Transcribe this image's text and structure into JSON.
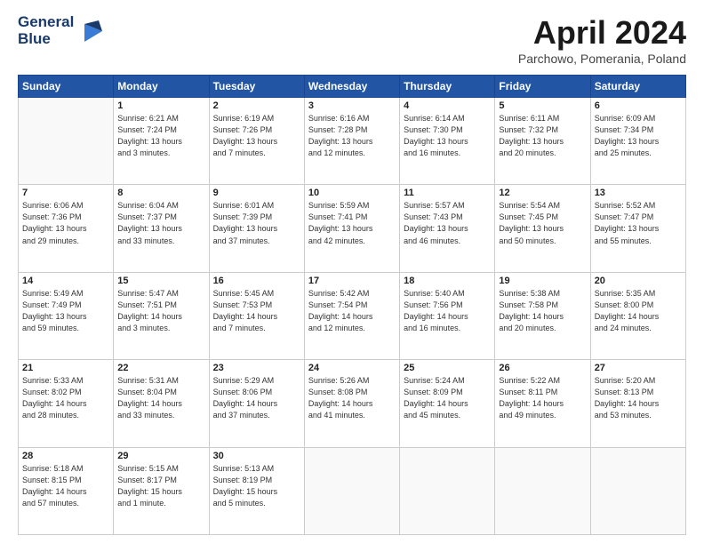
{
  "logo": {
    "line1": "General",
    "line2": "Blue"
  },
  "header": {
    "title": "April 2024",
    "location": "Parchowo, Pomerania, Poland"
  },
  "days_of_week": [
    "Sunday",
    "Monday",
    "Tuesday",
    "Wednesday",
    "Thursday",
    "Friday",
    "Saturday"
  ],
  "weeks": [
    [
      {
        "day": "",
        "info": ""
      },
      {
        "day": "1",
        "info": "Sunrise: 6:21 AM\nSunset: 7:24 PM\nDaylight: 13 hours\nand 3 minutes."
      },
      {
        "day": "2",
        "info": "Sunrise: 6:19 AM\nSunset: 7:26 PM\nDaylight: 13 hours\nand 7 minutes."
      },
      {
        "day": "3",
        "info": "Sunrise: 6:16 AM\nSunset: 7:28 PM\nDaylight: 13 hours\nand 12 minutes."
      },
      {
        "day": "4",
        "info": "Sunrise: 6:14 AM\nSunset: 7:30 PM\nDaylight: 13 hours\nand 16 minutes."
      },
      {
        "day": "5",
        "info": "Sunrise: 6:11 AM\nSunset: 7:32 PM\nDaylight: 13 hours\nand 20 minutes."
      },
      {
        "day": "6",
        "info": "Sunrise: 6:09 AM\nSunset: 7:34 PM\nDaylight: 13 hours\nand 25 minutes."
      }
    ],
    [
      {
        "day": "7",
        "info": "Sunrise: 6:06 AM\nSunset: 7:36 PM\nDaylight: 13 hours\nand 29 minutes."
      },
      {
        "day": "8",
        "info": "Sunrise: 6:04 AM\nSunset: 7:37 PM\nDaylight: 13 hours\nand 33 minutes."
      },
      {
        "day": "9",
        "info": "Sunrise: 6:01 AM\nSunset: 7:39 PM\nDaylight: 13 hours\nand 37 minutes."
      },
      {
        "day": "10",
        "info": "Sunrise: 5:59 AM\nSunset: 7:41 PM\nDaylight: 13 hours\nand 42 minutes."
      },
      {
        "day": "11",
        "info": "Sunrise: 5:57 AM\nSunset: 7:43 PM\nDaylight: 13 hours\nand 46 minutes."
      },
      {
        "day": "12",
        "info": "Sunrise: 5:54 AM\nSunset: 7:45 PM\nDaylight: 13 hours\nand 50 minutes."
      },
      {
        "day": "13",
        "info": "Sunrise: 5:52 AM\nSunset: 7:47 PM\nDaylight: 13 hours\nand 55 minutes."
      }
    ],
    [
      {
        "day": "14",
        "info": "Sunrise: 5:49 AM\nSunset: 7:49 PM\nDaylight: 13 hours\nand 59 minutes."
      },
      {
        "day": "15",
        "info": "Sunrise: 5:47 AM\nSunset: 7:51 PM\nDaylight: 14 hours\nand 3 minutes."
      },
      {
        "day": "16",
        "info": "Sunrise: 5:45 AM\nSunset: 7:53 PM\nDaylight: 14 hours\nand 7 minutes."
      },
      {
        "day": "17",
        "info": "Sunrise: 5:42 AM\nSunset: 7:54 PM\nDaylight: 14 hours\nand 12 minutes."
      },
      {
        "day": "18",
        "info": "Sunrise: 5:40 AM\nSunset: 7:56 PM\nDaylight: 14 hours\nand 16 minutes."
      },
      {
        "day": "19",
        "info": "Sunrise: 5:38 AM\nSunset: 7:58 PM\nDaylight: 14 hours\nand 20 minutes."
      },
      {
        "day": "20",
        "info": "Sunrise: 5:35 AM\nSunset: 8:00 PM\nDaylight: 14 hours\nand 24 minutes."
      }
    ],
    [
      {
        "day": "21",
        "info": "Sunrise: 5:33 AM\nSunset: 8:02 PM\nDaylight: 14 hours\nand 28 minutes."
      },
      {
        "day": "22",
        "info": "Sunrise: 5:31 AM\nSunset: 8:04 PM\nDaylight: 14 hours\nand 33 minutes."
      },
      {
        "day": "23",
        "info": "Sunrise: 5:29 AM\nSunset: 8:06 PM\nDaylight: 14 hours\nand 37 minutes."
      },
      {
        "day": "24",
        "info": "Sunrise: 5:26 AM\nSunset: 8:08 PM\nDaylight: 14 hours\nand 41 minutes."
      },
      {
        "day": "25",
        "info": "Sunrise: 5:24 AM\nSunset: 8:09 PM\nDaylight: 14 hours\nand 45 minutes."
      },
      {
        "day": "26",
        "info": "Sunrise: 5:22 AM\nSunset: 8:11 PM\nDaylight: 14 hours\nand 49 minutes."
      },
      {
        "day": "27",
        "info": "Sunrise: 5:20 AM\nSunset: 8:13 PM\nDaylight: 14 hours\nand 53 minutes."
      }
    ],
    [
      {
        "day": "28",
        "info": "Sunrise: 5:18 AM\nSunset: 8:15 PM\nDaylight: 14 hours\nand 57 minutes."
      },
      {
        "day": "29",
        "info": "Sunrise: 5:15 AM\nSunset: 8:17 PM\nDaylight: 15 hours\nand 1 minute."
      },
      {
        "day": "30",
        "info": "Sunrise: 5:13 AM\nSunset: 8:19 PM\nDaylight: 15 hours\nand 5 minutes."
      },
      {
        "day": "",
        "info": ""
      },
      {
        "day": "",
        "info": ""
      },
      {
        "day": "",
        "info": ""
      },
      {
        "day": "",
        "info": ""
      }
    ]
  ]
}
